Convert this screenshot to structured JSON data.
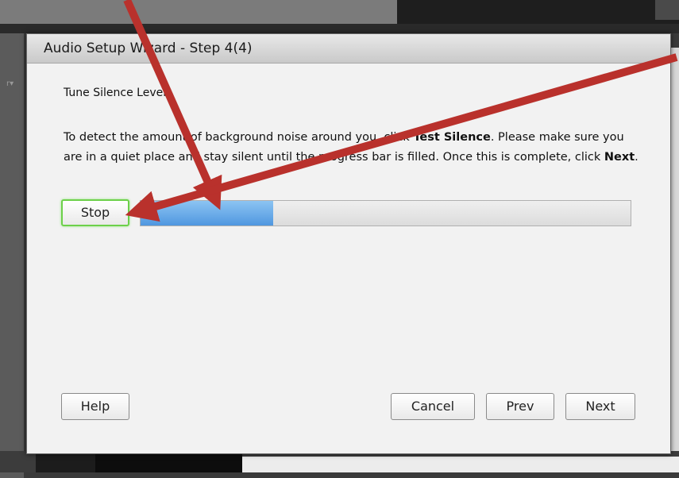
{
  "dialog": {
    "title": "Audio Setup Wizard - Step 4(4)",
    "section_title": "Tune Silence Level",
    "description": {
      "part1": "To detect the amount of background noise around you, click ",
      "bold1": "Test Silence",
      "part2": ". Please make sure you are in a quiet place and stay silent until the progress bar is filled. Once this is complete, click ",
      "bold2": "Next",
      "part3": "."
    },
    "stop_label": "Stop",
    "progress_fraction": 0.27,
    "buttons": {
      "help": "Help",
      "cancel": "Cancel",
      "prev": "Prev",
      "next": "Next"
    }
  },
  "background": {
    "left_mark": "r▾"
  },
  "colors": {
    "annotation_arrow": "#b9312c",
    "stop_highlight": "#6cd04a",
    "progress_fill": "#4f97e0"
  },
  "icons": [
    "annotation-arrow"
  ]
}
